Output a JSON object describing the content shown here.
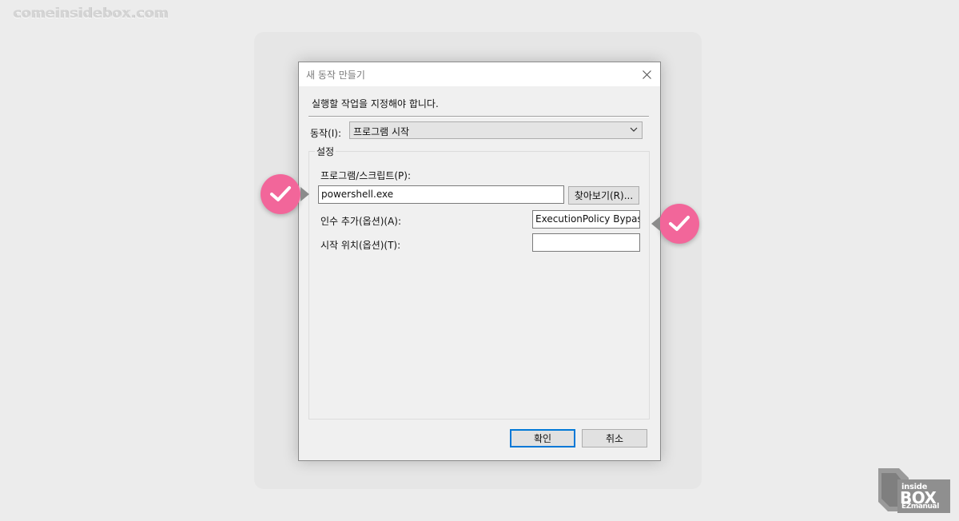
{
  "watermark": "comeinsidebox.com",
  "dialog": {
    "title": "새 동작 만들기",
    "instruction": "실행할 작업을 지정해야 합니다.",
    "action": {
      "label": "동작(I):",
      "selected": "프로그램 시작"
    },
    "settings": {
      "group_label": "설정",
      "program": {
        "label": "프로그램/스크립트(P):",
        "value": "powershell.exe",
        "browse_label": "찾아보기(R)..."
      },
      "arguments": {
        "label": "인수 추가(옵션)(A):",
        "value": "ExecutionPolicy Bypass"
      },
      "start_in": {
        "label": "시작 위치(옵션)(T):",
        "value": ""
      }
    },
    "buttons": {
      "ok": "확인",
      "cancel": "취소"
    }
  },
  "colors": {
    "accent": "#0078d7",
    "check_badge": "#f2669a"
  },
  "logo": {
    "line1": "inside",
    "line2": "BOX",
    "line3": "EZmanual"
  }
}
